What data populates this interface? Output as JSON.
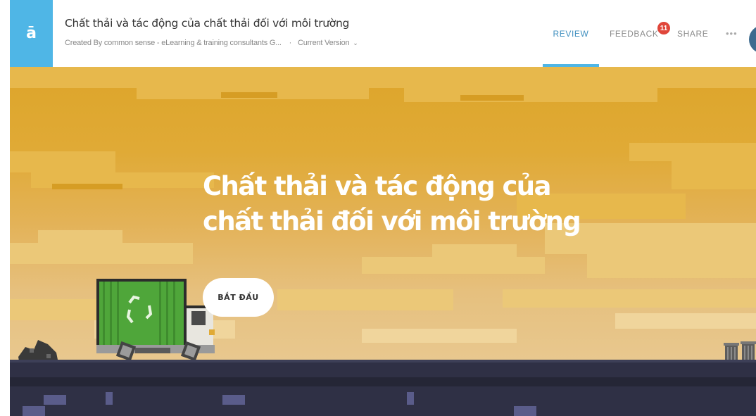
{
  "header": {
    "logo_glyph": "ā",
    "course_title": "Chất thải và tác động của chất thải đối với môi trường",
    "created_by": "Created By common sense - eLearning & training consultants G...",
    "separator": "·",
    "version": "Current Version",
    "version_chevron": "⌄",
    "nav": {
      "review": "REVIEW",
      "feedback": "FEEDBACK",
      "feedback_count": "11",
      "share": "SHARE",
      "more": "•••"
    }
  },
  "hero": {
    "title": "Chất thải và tác động của chất thải đối với môi trường",
    "start_button": "BẮT ĐẦU"
  },
  "colors": {
    "accent": "#4fb6e6",
    "review_active": "#3f8fbf",
    "badge": "#e0463a",
    "sky_top": "#dda52a",
    "sky_bottom": "#e8c88f",
    "road": "#2f3045",
    "truck_container": "#4fa63a"
  },
  "icons": {
    "logo": "rise-logo-icon",
    "recycle": "recycle-icon",
    "more": "more-dots-icon"
  }
}
